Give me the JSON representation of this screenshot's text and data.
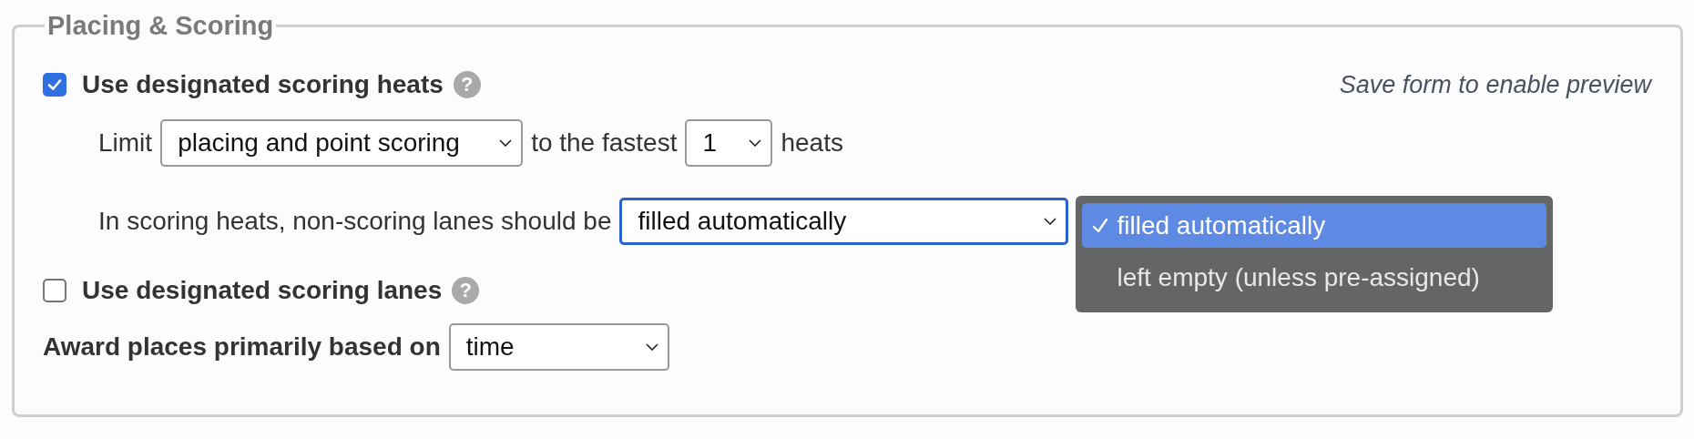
{
  "legend": "Placing & Scoring",
  "preview_note": "Save form to enable preview",
  "scoring_heats": {
    "label": "Use designated scoring heats",
    "checked": true,
    "help": "?",
    "limit_row": {
      "prefix": "Limit",
      "scope_select": "placing and point scoring",
      "middle": "to the fastest",
      "count_select": "1",
      "suffix": "heats"
    },
    "lanes_row": {
      "label": "In scoring heats, non-scoring lanes should be",
      "select": {
        "value": "filled automatically",
        "focused": true,
        "open": true,
        "options": [
          {
            "label": "filled automatically",
            "selected": true
          },
          {
            "label": "left empty (unless pre-assigned)",
            "selected": false
          }
        ]
      }
    }
  },
  "scoring_lanes": {
    "label": "Use designated scoring lanes",
    "checked": false,
    "help": "?"
  },
  "award": {
    "label": "Award places primarily based on",
    "select": "time"
  }
}
